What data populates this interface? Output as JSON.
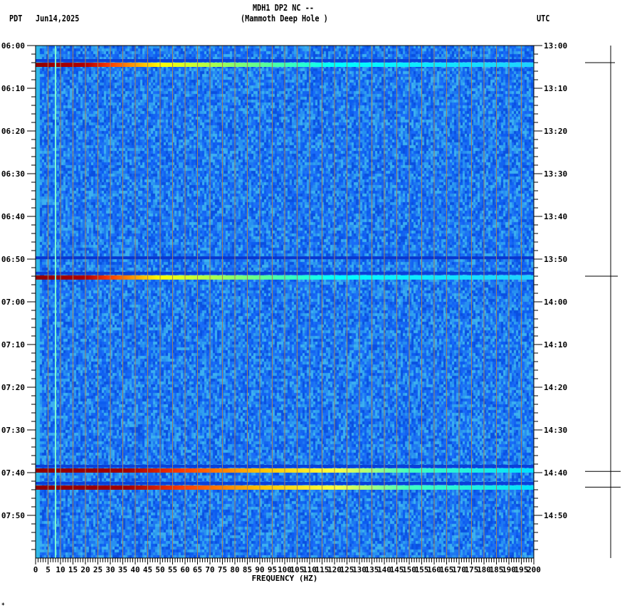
{
  "header": {
    "title": "MDH1 DP2 NC --",
    "subtitle": "(Mammoth Deep Hole )",
    "left_tz": "PDT",
    "date": "Jun14,2025",
    "right_tz": "UTC"
  },
  "footer_mark": "*",
  "chart_data": {
    "type": "heatmap",
    "title": "MDH1 DP2 NC --",
    "xlabel": "FREQUENCY (HZ)",
    "xlim": [
      0,
      200
    ],
    "x_ticks": [
      "0",
      "5",
      "10",
      "15",
      "20",
      "25",
      "30",
      "35",
      "40",
      "45",
      "50",
      "55",
      "60",
      "65",
      "70",
      "75",
      "80",
      "85",
      "90",
      "95",
      "100",
      "105",
      "110",
      "115",
      "120",
      "125",
      "130",
      "135",
      "140",
      "145",
      "150",
      "155",
      "160",
      "165",
      "170",
      "175",
      "180",
      "185",
      "190",
      "195",
      "200"
    ],
    "y_range_minutes": [
      0,
      120
    ],
    "y_ticks_left": [
      "06:00",
      "06:10",
      "06:20",
      "06:30",
      "06:40",
      "06:50",
      "07:00",
      "07:10",
      "07:20",
      "07:30",
      "07:40",
      "07:50"
    ],
    "y_ticks_right": [
      "13:00",
      "13:10",
      "13:20",
      "13:30",
      "13:40",
      "13:50",
      "14:00",
      "14:10",
      "14:20",
      "14:30",
      "14:40",
      "14:50"
    ],
    "grid_every_hz": 5,
    "persistent_line_hz": 8,
    "events": [
      {
        "minute": 4.5,
        "strength": 0.7
      },
      {
        "minute": 54.3,
        "strength": 0.7
      },
      {
        "minute": 49.7,
        "strength": 0.0
      },
      {
        "minute": 99.5,
        "strength": 1.0
      },
      {
        "minute": 103.5,
        "strength": 1.0
      }
    ],
    "trace_marks_minutes": [
      4,
      54,
      99.7,
      103.4
    ],
    "colors": {
      "background": "#1a78f0",
      "grid": "#a08060",
      "line": "#7fffd0"
    }
  }
}
